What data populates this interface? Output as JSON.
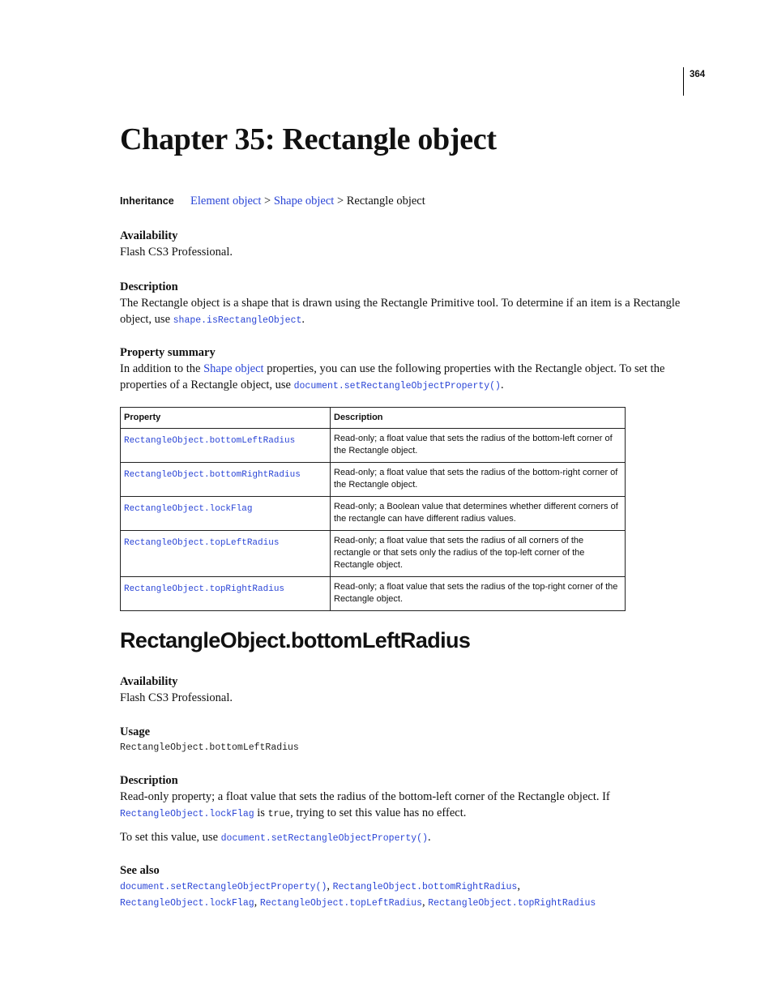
{
  "page_number": "364",
  "chapter_title": "Chapter 35: Rectangle object",
  "inheritance": {
    "label": "Inheritance",
    "links": [
      "Element object",
      "Shape object"
    ],
    "separator": " > ",
    "current": "Rectangle object"
  },
  "availability": {
    "heading": "Availability",
    "text": "Flash CS3 Professional."
  },
  "description": {
    "heading": "Description",
    "text_before": "The Rectangle object is a shape that is drawn using the Rectangle Primitive tool. To determine if an item is a Rectangle object, use ",
    "code_link": "shape.isRectangleObject",
    "text_after": "."
  },
  "property_summary": {
    "heading": "Property summary",
    "text_1": "In addition to the ",
    "link": "Shape object",
    "text_2": " properties, you can use the following properties with the Rectangle object. To set the properties of a Rectangle object, use ",
    "code_link": "document.setRectangleObjectProperty()",
    "text_3": "."
  },
  "table": {
    "headers": [
      "Property",
      "Description"
    ],
    "rows": [
      {
        "property": "RectangleObject.bottomLeftRadius",
        "description": "Read-only; a float value that sets the radius of the bottom-left corner of the Rectangle object."
      },
      {
        "property": "RectangleObject.bottomRightRadius",
        "description": "Read-only; a float value that sets the radius of the bottom-right corner of the Rectangle object."
      },
      {
        "property": "RectangleObject.lockFlag",
        "description": "Read-only; a Boolean value that determines whether different corners of the rectangle can have different radius values."
      },
      {
        "property": "RectangleObject.topLeftRadius",
        "description": "Read-only; a float value that sets the radius of all corners of the rectangle or that sets only the radius of the top-left corner of the Rectangle object."
      },
      {
        "property": "RectangleObject.topRightRadius",
        "description": "Read-only; a float value that sets the radius of the top-right corner of the Rectangle object."
      }
    ]
  },
  "section": {
    "title": "RectangleObject.bottomLeftRadius",
    "availability": {
      "heading": "Availability",
      "text": "Flash CS3 Professional."
    },
    "usage": {
      "heading": "Usage",
      "code": "RectangleObject.bottomLeftRadius"
    },
    "description": {
      "heading": "Description",
      "text_1": "Read-only property; a float value that sets the radius of the bottom-left corner of the Rectangle object. If ",
      "code_link": "RectangleObject.lockFlag",
      "text_2": " is ",
      "code_value": "true",
      "text_3": ", trying to set this value has no effect.",
      "set_text": "To set this value, use ",
      "set_link": "document.setRectangleObjectProperty()",
      "set_after": "."
    },
    "see_also": {
      "heading": "See also",
      "links": [
        "document.setRectangleObjectProperty()",
        "RectangleObject.bottomRightRadius",
        "RectangleObject.lockFlag",
        "RectangleObject.topLeftRadius",
        "RectangleObject.topRightRadius"
      ],
      "separator": ", "
    }
  },
  "colors": {
    "link": "#2a45d6",
    "text": "#111111"
  }
}
